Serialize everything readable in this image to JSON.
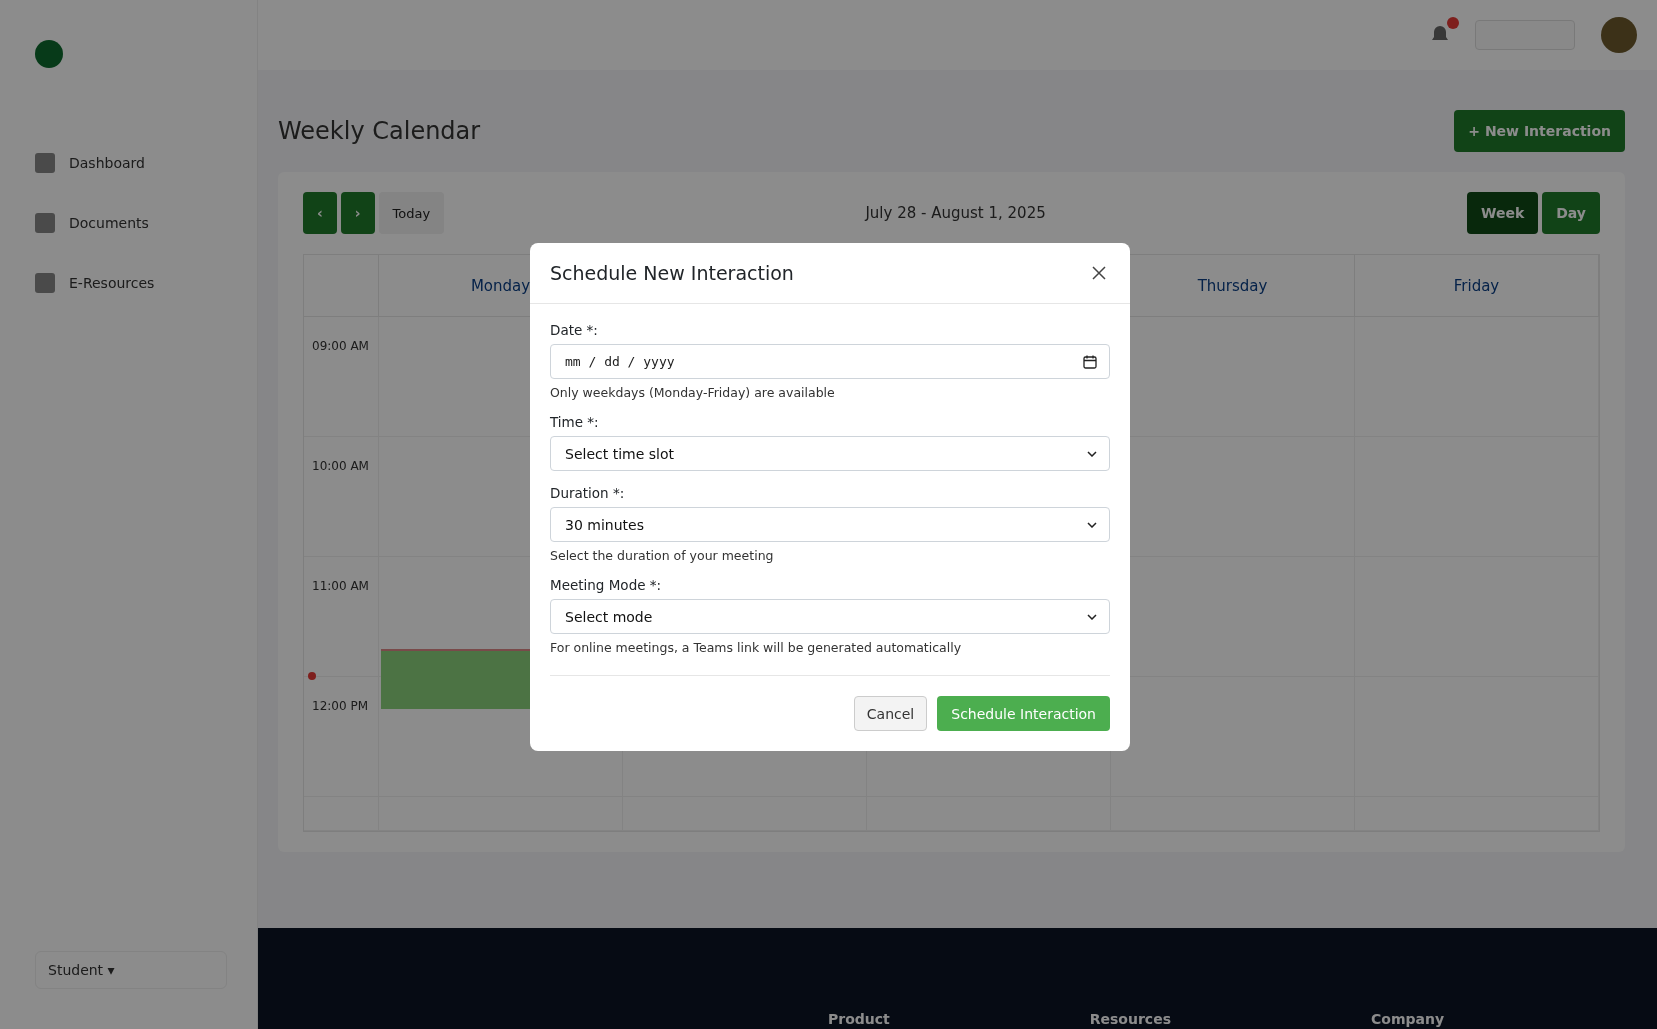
{
  "sidebar": {
    "items": [
      {
        "label": "Dashboard"
      },
      {
        "label": "Documents"
      },
      {
        "label": "E-Resources"
      }
    ],
    "user": {
      "label": "Student",
      "caret": "▾"
    }
  },
  "page": {
    "title": "Weekly Calendar",
    "new_button": "New Interaction",
    "new_icon": "+"
  },
  "calendar": {
    "prev": "‹",
    "next": "›",
    "today_button": "Today",
    "range": "July 28 - August 1, 2025",
    "views": [
      {
        "label": "Week",
        "selected": true
      },
      {
        "label": "Day",
        "selected": false
      }
    ],
    "columns": [
      {
        "label": "Monday",
        "has_event": true
      },
      {},
      {},
      {
        "label": "Thursday",
        "has_event": false
      },
      {
        "label": "Friday",
        "has_event": false
      }
    ],
    "times": [
      "09:00 AM",
      "10:00 AM",
      "11:00 AM",
      "12:00 PM"
    ]
  },
  "footer": {
    "headings": [
      "Product",
      "Resources",
      "Company"
    ]
  },
  "dialog": {
    "title": "Schedule New Interaction",
    "fields": [
      {
        "kind": "date",
        "label": "Date *:",
        "placeholder": "mm / dd / yyyy",
        "hint": "Only weekdays (Monday-Friday) are available"
      },
      {
        "kind": "select",
        "label": "Time *:",
        "value": "Select time slot"
      },
      {
        "kind": "select",
        "label": "Duration *:",
        "value": "30 minutes",
        "hint": "Select the duration of your meeting"
      },
      {
        "kind": "select",
        "label": "Meeting Mode *:",
        "value": "Select mode",
        "hint": "For online meetings, a Teams link will be generated automatically"
      }
    ],
    "cancel": "Cancel",
    "submit": "Schedule Interaction"
  }
}
